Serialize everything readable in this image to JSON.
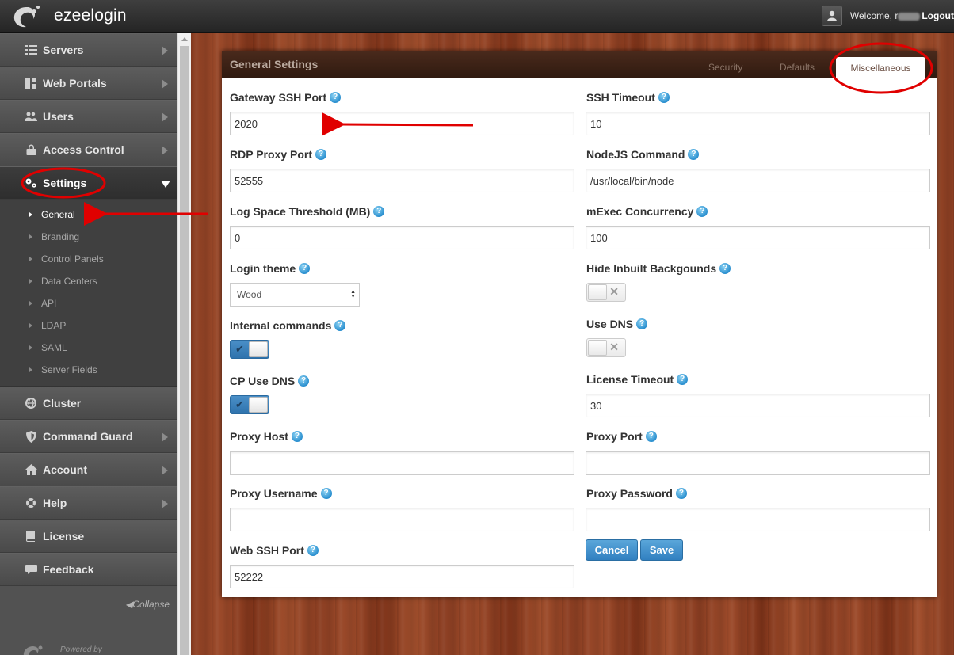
{
  "app": {
    "name": "ezeelogin"
  },
  "header": {
    "welcome": "Welcome, r",
    "logout": "Logout"
  },
  "sidebar": {
    "items": [
      {
        "label": "Servers",
        "icon": "list-icon"
      },
      {
        "label": "Web Portals",
        "icon": "grid-icon"
      },
      {
        "label": "Users",
        "icon": "users-icon"
      },
      {
        "label": "Access Control",
        "icon": "lock-icon"
      },
      {
        "label": "Settings",
        "icon": "gears-icon"
      }
    ],
    "submenu": [
      "General",
      "Branding",
      "Control Panels",
      "Data Centers",
      "API",
      "LDAP",
      "SAML",
      "Server Fields"
    ],
    "items_after": [
      {
        "label": "Cluster",
        "icon": "globe-icon"
      },
      {
        "label": "Command Guard",
        "icon": "shield-icon"
      },
      {
        "label": "Account",
        "icon": "home-icon"
      },
      {
        "label": "Help",
        "icon": "lifebuoy-icon"
      },
      {
        "label": "License",
        "icon": "book-icon"
      },
      {
        "label": "Feedback",
        "icon": "comment-icon"
      }
    ],
    "collapse": "◀Collapse",
    "powered_by": "Powered by"
  },
  "panel": {
    "title": "General Settings",
    "tabs": [
      "Security",
      "Defaults",
      "Miscellaneous"
    ],
    "active_tab": "Miscellaneous"
  },
  "form": {
    "gateway_ssh_port": {
      "label": "Gateway SSH Port",
      "value": "2020"
    },
    "ssh_timeout": {
      "label": "SSH Timeout",
      "value": "10"
    },
    "rdp_proxy_port": {
      "label": "RDP Proxy Port",
      "value": "52555"
    },
    "nodejs_command": {
      "label": "NodeJS Command",
      "value": "/usr/local/bin/node"
    },
    "log_space_threshold": {
      "label": "Log Space Threshold (MB)",
      "value": "0"
    },
    "mexec_concurrency": {
      "label": "mExec Concurrency",
      "value": "100"
    },
    "login_theme": {
      "label": "Login theme",
      "value": "Wood"
    },
    "hide_inbuilt_backgrounds": {
      "label": "Hide Inbuilt Backgounds",
      "state": "off"
    },
    "internal_commands": {
      "label": "Internal commands",
      "state": "on"
    },
    "use_dns": {
      "label": "Use DNS",
      "state": "off"
    },
    "cp_use_dns": {
      "label": "CP Use DNS",
      "state": "on"
    },
    "license_timeout": {
      "label": "License Timeout",
      "value": "30"
    },
    "proxy_host": {
      "label": "Proxy Host",
      "value": ""
    },
    "proxy_port": {
      "label": "Proxy Port",
      "value": ""
    },
    "proxy_username": {
      "label": "Proxy Username",
      "value": ""
    },
    "proxy_password": {
      "label": "Proxy Password",
      "value": ""
    },
    "web_ssh_port": {
      "label": "Web SSH Port",
      "value": "52222"
    }
  },
  "buttons": {
    "cancel": "Cancel",
    "save": "Save"
  },
  "colors": {
    "accent": "#3180c0",
    "annotation": "#e00000",
    "panel_header": "#3a2115"
  }
}
